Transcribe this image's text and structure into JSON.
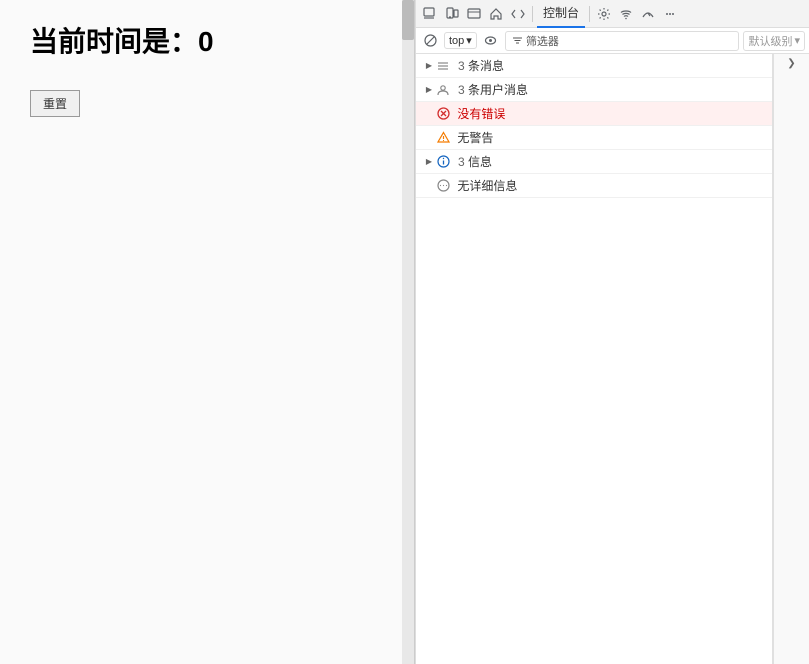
{
  "main": {
    "title": "当前时间是：0",
    "reset_button": "重置"
  },
  "devtools": {
    "toolbar": {
      "console_label": "控制台",
      "top_dropdown": "top",
      "filter_placeholder": "筛选器",
      "default_level": "默认级别",
      "icons": [
        "inspect",
        "device",
        "elements",
        "home",
        "code",
        "console",
        "settings",
        "wifi",
        "performance",
        "gear"
      ]
    },
    "console_items": [
      {
        "id": 1,
        "icon": "lines",
        "count": "3",
        "text": "条消息",
        "expandable": true,
        "expanded": false,
        "level": "default"
      },
      {
        "id": 2,
        "icon": "user",
        "count": "3",
        "text": "条用户消息",
        "expandable": true,
        "expanded": false,
        "level": "default"
      },
      {
        "id": 3,
        "icon": "error",
        "count": "",
        "text": "没有错误",
        "expandable": false,
        "expanded": false,
        "level": "error",
        "selected": true
      },
      {
        "id": 4,
        "icon": "warning",
        "count": "",
        "text": "无警告",
        "expandable": false,
        "expanded": false,
        "level": "warning"
      },
      {
        "id": 5,
        "icon": "info",
        "count": "3",
        "text": "信息",
        "expandable": true,
        "expanded": false,
        "level": "info"
      },
      {
        "id": 6,
        "icon": "verbose",
        "count": "",
        "text": "无详细信息",
        "expandable": false,
        "expanded": false,
        "level": "verbose"
      }
    ]
  }
}
